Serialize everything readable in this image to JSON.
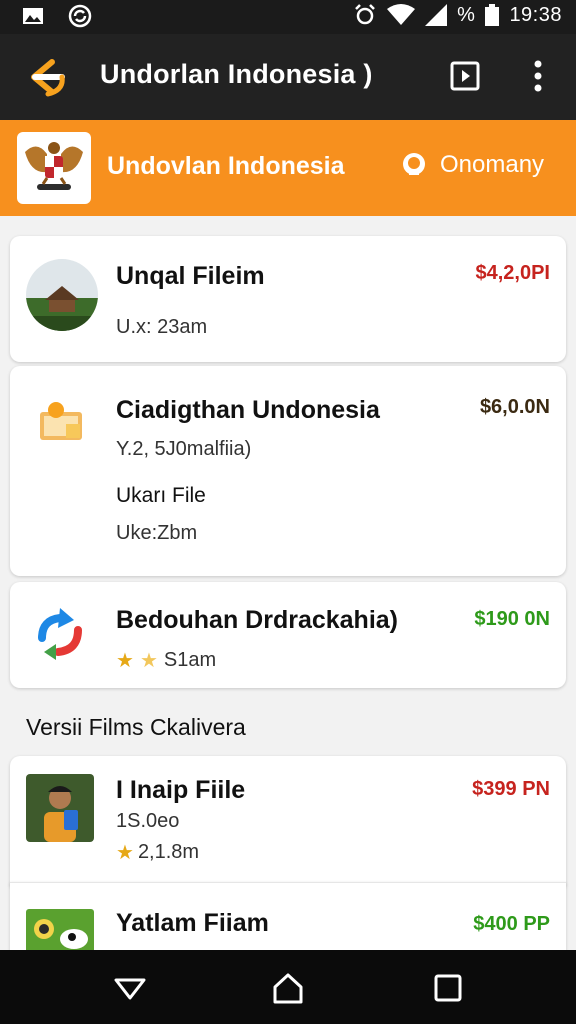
{
  "status_bar": {
    "time": "19:38",
    "battery": "%"
  },
  "app_bar": {
    "title": "Undorlan Indonesia )",
    "back_icon": "back-arrow-icon",
    "action_icon": "play-box-icon",
    "more_icon": "more-vert-icon"
  },
  "banner": {
    "title": "Undovlan Indonesia",
    "company_label": "Onomany"
  },
  "list": [
    {
      "name": "Unqal Fileim",
      "price": "$4,2,0PI",
      "price_color": "#c6231e",
      "sub1": "U.x: 23am"
    },
    {
      "name": "Ciadigthan Undonesia",
      "price": "$6,0.0N",
      "price_color": "#3b2a12",
      "sub1": "Y.2, 5J0malfiia)",
      "sub2": "Ukarı File",
      "sub3": "Uke:Zbm"
    },
    {
      "name": "Bedouhan Drdrackahia)",
      "price": "$190 0N",
      "price_color": "#2e9a1a",
      "rating": "S1am"
    }
  ],
  "section": {
    "title": "Versii Films Ckalivera"
  },
  "list2": [
    {
      "name": "I Inaip Fiile",
      "price": "$399 PN",
      "price_color": "#c6231e",
      "sub1": "1S.0eo",
      "rating": "2,1.8m"
    },
    {
      "name": "Yatlam Fiiam",
      "price": "$400 PP",
      "price_color": "#2e9a1a"
    }
  ],
  "nav": {
    "back": "back-triangle-icon",
    "home": "home-icon",
    "recents": "recents-square-icon"
  }
}
